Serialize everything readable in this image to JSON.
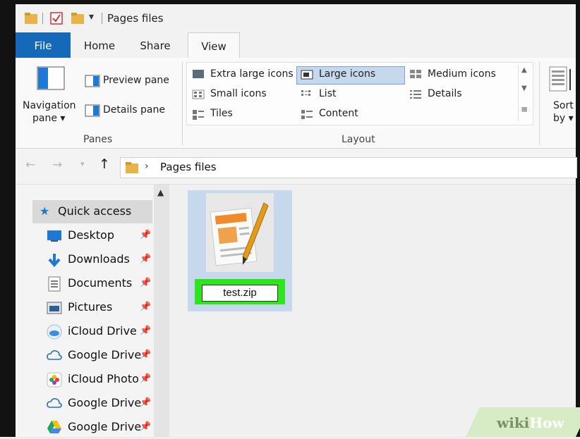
{
  "window": {
    "title": "Pages files"
  },
  "tabs": [
    {
      "label": "File"
    },
    {
      "label": "Home"
    },
    {
      "label": "Share"
    },
    {
      "label": "View"
    }
  ],
  "ribbon": {
    "panes": {
      "navigation_pane": "Navigation",
      "navigation_pane_line2": "pane ▾",
      "preview_pane": "Preview pane",
      "details_pane": "Details pane",
      "group_label": "Panes"
    },
    "layout": {
      "extra_large_icons": "Extra large icons",
      "large_icons": "Large icons",
      "medium_icons": "Medium icons",
      "small_icons": "Small icons",
      "list": "List",
      "details": "Details",
      "tiles": "Tiles",
      "content": "Content",
      "group_label": "Layout",
      "selected": "Large icons"
    },
    "sort": {
      "label": "Sort",
      "label_line2": "by ▾"
    }
  },
  "address": {
    "crumb": "Pages files"
  },
  "nav": {
    "items": [
      {
        "label": "Quick access",
        "pinned": false
      },
      {
        "label": "Desktop",
        "pinned": true
      },
      {
        "label": "Downloads",
        "pinned": true
      },
      {
        "label": "Documents",
        "pinned": true
      },
      {
        "label": "Pictures",
        "pinned": true
      },
      {
        "label": "iCloud Drive",
        "pinned": true
      },
      {
        "label": "Google Drive",
        "pinned": true
      },
      {
        "label": "iCloud Photo",
        "pinned": true
      },
      {
        "label": "Google Drive",
        "pinned": true
      },
      {
        "label": "Google Drive",
        "pinned": true
      }
    ]
  },
  "file": {
    "rename_value": "test.zip"
  },
  "watermark": {
    "part1": "wiki",
    "part2": "How"
  },
  "colors": {
    "accent": "#1569b8",
    "highlight": "#2ee51d",
    "selection": "#c6d9ec"
  }
}
